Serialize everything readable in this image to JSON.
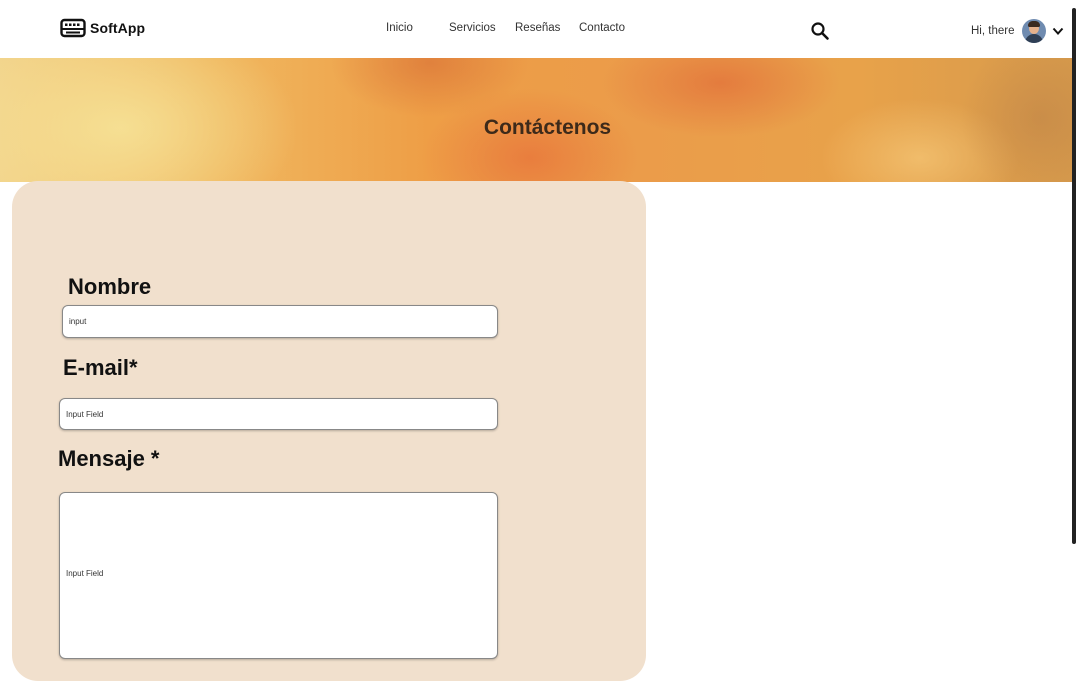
{
  "header": {
    "brand": "SoftApp",
    "logo_icon": "keyboard-icon",
    "nav": [
      "Inicio",
      "Servicios",
      "Reseñas",
      "Contacto"
    ],
    "search_icon": "search-icon",
    "greeting": "Hi, there",
    "chevron_icon": "chevron-down-icon"
  },
  "hero": {
    "title": "Contáctenos"
  },
  "form": {
    "name": {
      "label": "Nombre",
      "value": "input"
    },
    "email": {
      "label": "E-mail*",
      "value": "Input Field"
    },
    "message": {
      "label": "Mensaje *",
      "value": "Input Field"
    }
  },
  "colors": {
    "card_background": "#f1e0cd",
    "hero_orange": "#ee9e46"
  }
}
